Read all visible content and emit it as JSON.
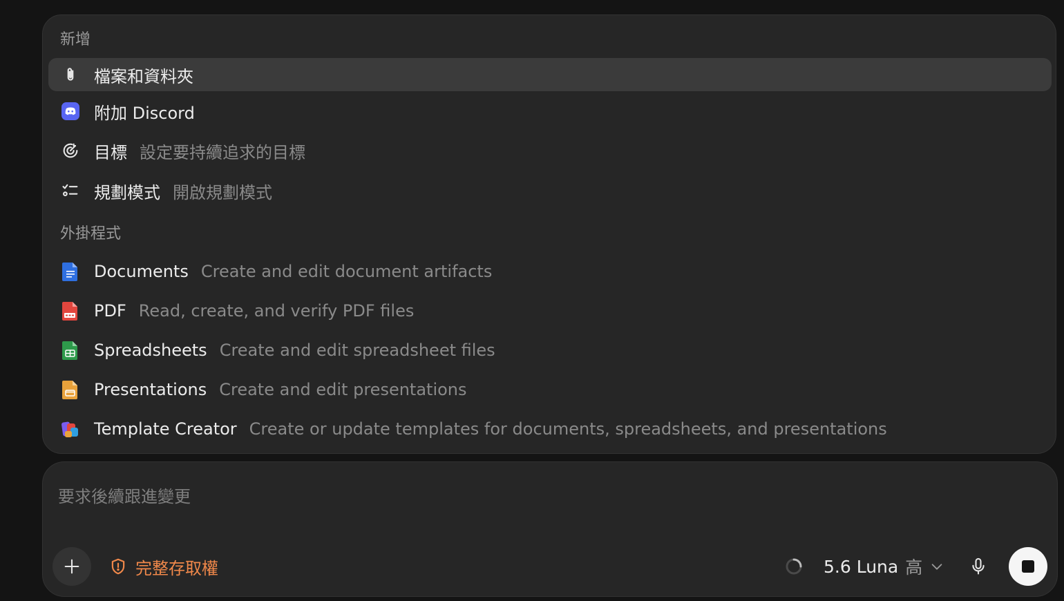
{
  "menu": {
    "add_section_header": "新增",
    "add_items": [
      {
        "label": "檔案和資料夾",
        "description": "",
        "icon": "paperclip-icon"
      },
      {
        "label": "附加 Discord",
        "description": "",
        "icon": "discord-icon"
      },
      {
        "label": "目標",
        "description": "設定要持續追求的目標",
        "icon": "target-icon"
      },
      {
        "label": "規劃模式",
        "description": "開啟規劃模式",
        "icon": "checklist-icon"
      }
    ],
    "plugins_section_header": "外掛程式",
    "plugin_items": [
      {
        "label": "Documents",
        "description": "Create and edit document artifacts",
        "icon": "documents-icon",
        "color": "#2f6fe0"
      },
      {
        "label": "PDF",
        "description": "Read, create, and verify PDF files",
        "icon": "pdf-icon",
        "color": "#e2463e"
      },
      {
        "label": "Spreadsheets",
        "description": "Create and edit spreadsheet files",
        "icon": "spreadsheets-icon",
        "color": "#2e9a4b"
      },
      {
        "label": "Presentations",
        "description": "Create and edit presentations",
        "icon": "presentations-icon",
        "color": "#e9a23b"
      },
      {
        "label": "Template Creator",
        "description": "Create or update templates for documents, spreadsheets, and presentations",
        "icon": "template-creator-icon",
        "color": "#7a5cf0"
      }
    ]
  },
  "composer": {
    "placeholder": "要求後續跟進變更",
    "access_label": "完整存取權",
    "model_name": "5.6 Luna",
    "model_effort": "高"
  },
  "colors": {
    "accent_orange": "#f0884a",
    "selected_row": "#3b3b3b",
    "panel_bg": "#262626",
    "discord": "#5865f2"
  }
}
